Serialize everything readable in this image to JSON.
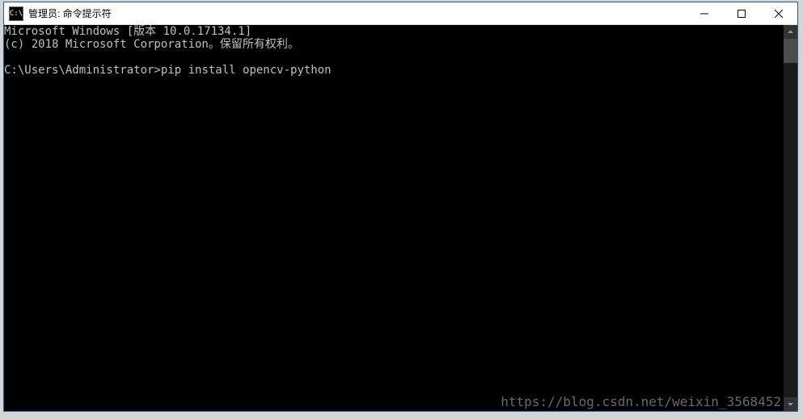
{
  "titlebar": {
    "icon_label": "C:\\",
    "title": "管理员: 命令提示符"
  },
  "console": {
    "line1": "Microsoft Windows [版本 10.0.17134.1]",
    "line2": "(c) 2018 Microsoft Corporation。保留所有权利。",
    "prompt": "C:\\Users\\Administrator>",
    "command": "pip install opencv-python"
  },
  "watermark": "https://blog.csdn.net/weixin_3568452"
}
